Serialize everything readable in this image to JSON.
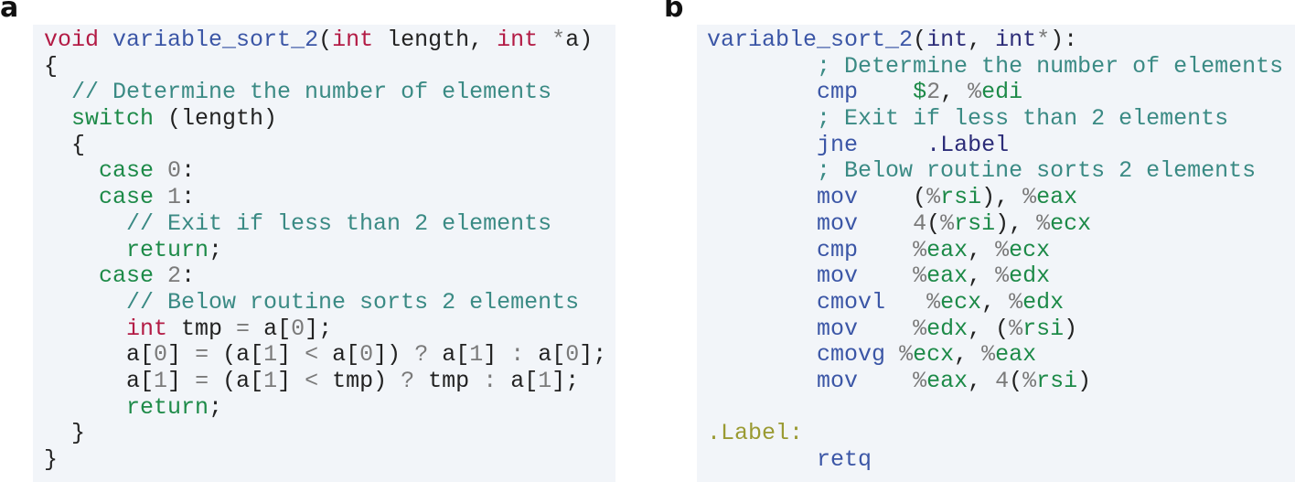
{
  "figure": {
    "panel_a": {
      "label": "a",
      "language": "C",
      "lines": [
        [
          [
            "type",
            "void"
          ],
          [
            "plain",
            " "
          ],
          [
            "fn",
            "variable_sort_2"
          ],
          [
            "plain",
            "("
          ],
          [
            "type",
            "int"
          ],
          [
            "plain",
            " length, "
          ],
          [
            "type",
            "int"
          ],
          [
            "plain",
            " "
          ],
          [
            "op",
            "*"
          ],
          [
            "plain",
            "a)"
          ]
        ],
        [
          [
            "plain",
            "{"
          ]
        ],
        [
          [
            "plain",
            "  "
          ],
          [
            "cm",
            "// Determine the number of elements"
          ]
        ],
        [
          [
            "plain",
            "  "
          ],
          [
            "kw",
            "switch"
          ],
          [
            "plain",
            " (length)"
          ]
        ],
        [
          [
            "plain",
            "  {"
          ]
        ],
        [
          [
            "plain",
            "    "
          ],
          [
            "kw",
            "case"
          ],
          [
            "plain",
            " "
          ],
          [
            "num",
            "0"
          ],
          [
            "plain",
            ":"
          ]
        ],
        [
          [
            "plain",
            "    "
          ],
          [
            "kw",
            "case"
          ],
          [
            "plain",
            " "
          ],
          [
            "num",
            "1"
          ],
          [
            "plain",
            ":"
          ]
        ],
        [
          [
            "plain",
            "      "
          ],
          [
            "cm",
            "// Exit if less than 2 elements"
          ]
        ],
        [
          [
            "plain",
            "      "
          ],
          [
            "kw",
            "return"
          ],
          [
            "plain",
            ";"
          ]
        ],
        [
          [
            "plain",
            "    "
          ],
          [
            "kw",
            "case"
          ],
          [
            "plain",
            " "
          ],
          [
            "num",
            "2"
          ],
          [
            "plain",
            ":"
          ]
        ],
        [
          [
            "plain",
            "      "
          ],
          [
            "cm",
            "// Below routine sorts 2 elements"
          ]
        ],
        [
          [
            "plain",
            "      "
          ],
          [
            "type",
            "int"
          ],
          [
            "plain",
            " tmp "
          ],
          [
            "op",
            "="
          ],
          [
            "plain",
            " a["
          ],
          [
            "num",
            "0"
          ],
          [
            "plain",
            "];"
          ]
        ],
        [
          [
            "plain",
            "      a["
          ],
          [
            "num",
            "0"
          ],
          [
            "plain",
            "] "
          ],
          [
            "op",
            "="
          ],
          [
            "plain",
            " (a["
          ],
          [
            "num",
            "1"
          ],
          [
            "plain",
            "] "
          ],
          [
            "op",
            "<"
          ],
          [
            "plain",
            " a["
          ],
          [
            "num",
            "0"
          ],
          [
            "plain",
            "]) "
          ],
          [
            "op",
            "?"
          ],
          [
            "plain",
            " a["
          ],
          [
            "num",
            "1"
          ],
          [
            "plain",
            "] "
          ],
          [
            "op",
            ":"
          ],
          [
            "plain",
            " a["
          ],
          [
            "num",
            "0"
          ],
          [
            "plain",
            "];"
          ]
        ],
        [
          [
            "plain",
            "      a["
          ],
          [
            "num",
            "1"
          ],
          [
            "plain",
            "] "
          ],
          [
            "op",
            "="
          ],
          [
            "plain",
            " (a["
          ],
          [
            "num",
            "1"
          ],
          [
            "plain",
            "] "
          ],
          [
            "op",
            "<"
          ],
          [
            "plain",
            " tmp) "
          ],
          [
            "op",
            "?"
          ],
          [
            "plain",
            " tmp "
          ],
          [
            "op",
            ":"
          ],
          [
            "plain",
            " a["
          ],
          [
            "num",
            "1"
          ],
          [
            "plain",
            "];"
          ]
        ],
        [
          [
            "plain",
            "      "
          ],
          [
            "kw",
            "return"
          ],
          [
            "plain",
            ";"
          ]
        ],
        [
          [
            "plain",
            "  }"
          ]
        ],
        [
          [
            "plain",
            "}"
          ]
        ]
      ]
    },
    "panel_b": {
      "label": "b",
      "language": "x86-64 assembly",
      "lines": [
        [
          [
            "fn",
            "variable_sort_2"
          ],
          [
            "plain",
            "("
          ],
          [
            "sym",
            "int"
          ],
          [
            "plain",
            ", "
          ],
          [
            "sym",
            "int"
          ],
          [
            "op",
            "*"
          ],
          [
            "plain",
            "):"
          ]
        ],
        [
          [
            "plain",
            "        "
          ],
          [
            "cm",
            "; Determine the number of elements"
          ]
        ],
        [
          [
            "plain",
            "        "
          ],
          [
            "mn",
            "cmp"
          ],
          [
            "plain",
            "    "
          ],
          [
            "reg",
            "$"
          ],
          [
            "num",
            "2"
          ],
          [
            "plain",
            ", "
          ],
          [
            "pct",
            "%"
          ],
          [
            "reg",
            "edi"
          ]
        ],
        [
          [
            "plain",
            "        "
          ],
          [
            "cm",
            "; Exit if less than 2 elements"
          ]
        ],
        [
          [
            "plain",
            "        "
          ],
          [
            "mn",
            "jne"
          ],
          [
            "plain",
            "     "
          ],
          [
            "sym",
            ".Label"
          ]
        ],
        [
          [
            "plain",
            "        "
          ],
          [
            "cm",
            "; Below routine sorts 2 elements"
          ]
        ],
        [
          [
            "plain",
            "        "
          ],
          [
            "mn",
            "mov"
          ],
          [
            "plain",
            "    ("
          ],
          [
            "pct",
            "%"
          ],
          [
            "reg",
            "rsi"
          ],
          [
            "plain",
            "), "
          ],
          [
            "pct",
            "%"
          ],
          [
            "reg",
            "eax"
          ]
        ],
        [
          [
            "plain",
            "        "
          ],
          [
            "mn",
            "mov"
          ],
          [
            "plain",
            "    "
          ],
          [
            "num",
            "4"
          ],
          [
            "plain",
            "("
          ],
          [
            "pct",
            "%"
          ],
          [
            "reg",
            "rsi"
          ],
          [
            "plain",
            "), "
          ],
          [
            "pct",
            "%"
          ],
          [
            "reg",
            "ecx"
          ]
        ],
        [
          [
            "plain",
            "        "
          ],
          [
            "mn",
            "cmp"
          ],
          [
            "plain",
            "    "
          ],
          [
            "pct",
            "%"
          ],
          [
            "reg",
            "eax"
          ],
          [
            "plain",
            ", "
          ],
          [
            "pct",
            "%"
          ],
          [
            "reg",
            "ecx"
          ]
        ],
        [
          [
            "plain",
            "        "
          ],
          [
            "mn",
            "mov"
          ],
          [
            "plain",
            "    "
          ],
          [
            "pct",
            "%"
          ],
          [
            "reg",
            "eax"
          ],
          [
            "plain",
            ", "
          ],
          [
            "pct",
            "%"
          ],
          [
            "reg",
            "edx"
          ]
        ],
        [
          [
            "plain",
            "        "
          ],
          [
            "mn",
            "cmovl"
          ],
          [
            "plain",
            "   "
          ],
          [
            "pct",
            "%"
          ],
          [
            "reg",
            "ecx"
          ],
          [
            "plain",
            ", "
          ],
          [
            "pct",
            "%"
          ],
          [
            "reg",
            "edx"
          ]
        ],
        [
          [
            "plain",
            "        "
          ],
          [
            "mn",
            "mov"
          ],
          [
            "plain",
            "    "
          ],
          [
            "pct",
            "%"
          ],
          [
            "reg",
            "edx"
          ],
          [
            "plain",
            ", ("
          ],
          [
            "pct",
            "%"
          ],
          [
            "reg",
            "rsi"
          ],
          [
            "plain",
            ")"
          ]
        ],
        [
          [
            "plain",
            "        "
          ],
          [
            "mn",
            "cmovg"
          ],
          [
            "plain",
            " "
          ],
          [
            "pct",
            "%"
          ],
          [
            "reg",
            "ecx"
          ],
          [
            "plain",
            ", "
          ],
          [
            "pct",
            "%"
          ],
          [
            "reg",
            "eax"
          ]
        ],
        [
          [
            "plain",
            "        "
          ],
          [
            "mn",
            "mov"
          ],
          [
            "plain",
            "    "
          ],
          [
            "pct",
            "%"
          ],
          [
            "reg",
            "eax"
          ],
          [
            "plain",
            ", "
          ],
          [
            "num",
            "4"
          ],
          [
            "plain",
            "("
          ],
          [
            "pct",
            "%"
          ],
          [
            "reg",
            "rsi"
          ],
          [
            "plain",
            ")"
          ]
        ],
        [
          [
            "plain",
            " "
          ]
        ],
        [
          [
            "label",
            ".Label:"
          ]
        ],
        [
          [
            "plain",
            "        "
          ],
          [
            "mn",
            "retq"
          ]
        ]
      ]
    },
    "colors": {
      "panel_background": "#f2f5f9",
      "c_type_keyword": "#b31b45",
      "function_name": "#3b56a6",
      "control_keyword": "#1d8a48",
      "comment": "#3a8a84",
      "number_operator": "#7a7a7a",
      "asm_mnemonic": "#3b56a6",
      "asm_register": "#1d8a48",
      "asm_label": "#9a9a32"
    }
  }
}
